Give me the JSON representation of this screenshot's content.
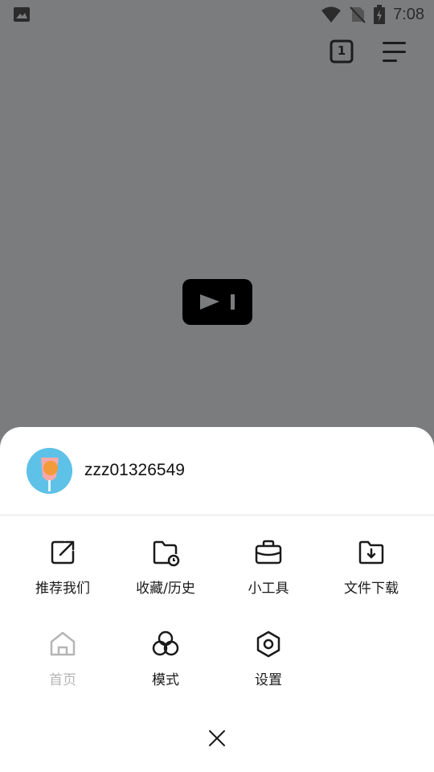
{
  "status_bar": {
    "time": "7:08",
    "icons": [
      "gallery-icon",
      "wifi-icon",
      "no-sim-icon",
      "battery-charging-icon"
    ]
  },
  "toolbar": {
    "tab_count": "1",
    "menu_icon": "hamburger-menu-icon"
  },
  "profile": {
    "username": "zzz01326549"
  },
  "menu": {
    "items": [
      {
        "label": "推荐我们",
        "icon": "share-icon"
      },
      {
        "label": "收藏/历史",
        "icon": "folder-history-icon"
      },
      {
        "label": "小工具",
        "icon": "toolbox-icon"
      },
      {
        "label": "文件下载",
        "icon": "download-folder-icon"
      },
      {
        "label": "首页",
        "icon": "home-icon"
      },
      {
        "label": "模式",
        "icon": "mode-icon"
      },
      {
        "label": "设置",
        "icon": "settings-icon"
      }
    ]
  },
  "colors": {
    "background": "#7b7c7e",
    "sheet": "#ffffff",
    "disabled_text": "#b5b5b5"
  }
}
